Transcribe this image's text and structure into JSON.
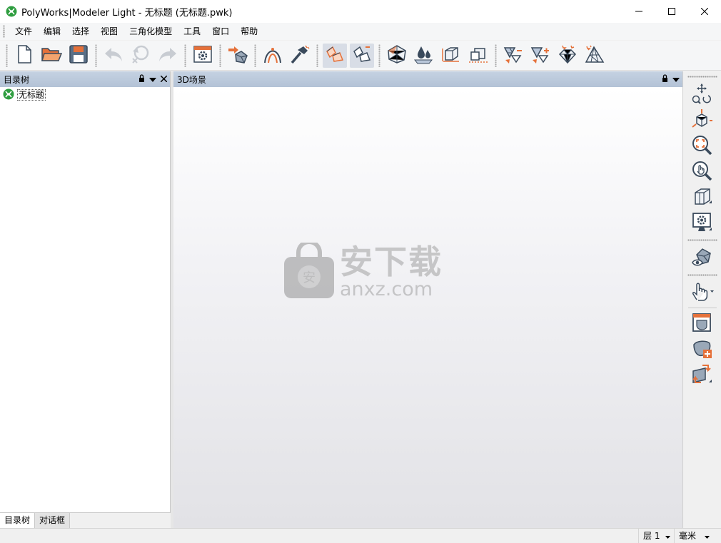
{
  "window": {
    "title": "PolyWorks|Modeler Light - 无标题 (无标题.pwk)"
  },
  "menu": {
    "items": [
      {
        "label": "文件"
      },
      {
        "label": "编辑"
      },
      {
        "label": "选择"
      },
      {
        "label": "视图"
      },
      {
        "label": "三角化模型"
      },
      {
        "label": "工具"
      },
      {
        "label": "窗口"
      },
      {
        "label": "帮助"
      }
    ]
  },
  "toolbar": {
    "icons": [
      "new-file-icon",
      "open-folder-icon",
      "save-icon",
      "undo-icon",
      "undo-disabled-icon",
      "redo-icon",
      "settings-window-icon",
      "import-object-icon",
      "curve-tool-icon",
      "repair-tool-icon",
      "select-polygons-icon",
      "deselect-polygons-icon",
      "mesh-sphere-icon",
      "fill-holes-icon",
      "bounding-box-icon",
      "object-clip-icon",
      "reduce-triangles-icon",
      "add-triangles-icon",
      "smooth-mesh-icon",
      "mesh-fix-icon"
    ]
  },
  "tree_panel": {
    "title": "目录树",
    "items": [
      {
        "label": "无标题"
      }
    ],
    "tabs": [
      {
        "label": "目录树"
      },
      {
        "label": "对话框"
      }
    ]
  },
  "scene_panel": {
    "title": "3D场景"
  },
  "watermark": {
    "cn": "安下载",
    "en": "anxz.com"
  },
  "statusbar": {
    "layer": "层 1",
    "unit": "毫米"
  },
  "colors": {
    "accent_orange": "#e5713a",
    "icon_dark": "#3a4a5c",
    "panel_header": "#b9c7da",
    "app_green": "#2e9d3f"
  }
}
